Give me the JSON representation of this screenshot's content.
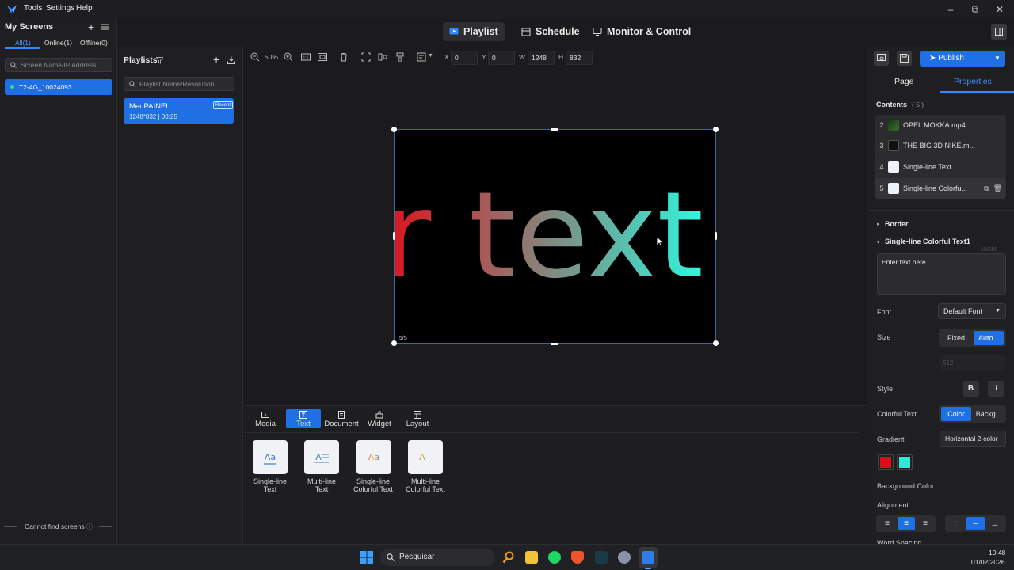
{
  "menu": {
    "tools": "Tools",
    "settings": "Settings",
    "help": "Help"
  },
  "nav": {
    "playlist": "Playlist",
    "schedule": "Schedule",
    "monitor": "Monitor & Control"
  },
  "screens": {
    "title": "My Screens",
    "tabs": {
      "all": "All(1)",
      "online": "Online(1)",
      "offline": "Offline(0)"
    },
    "search_placeholder": "Screen Name/IP Address...",
    "device": "T2-4G_10024093",
    "footer": "Cannot find screens"
  },
  "playlists": {
    "title": "Playlists",
    "search_placeholder": "Playlist Name/Resolution",
    "item": {
      "name": "MeuPAINEL",
      "badge": "Recent",
      "meta": "1248*832 | 00:25"
    }
  },
  "toolbar": {
    "zoom": "50%",
    "x_label": "X",
    "x": "0",
    "y_label": "Y",
    "y": "0",
    "w_label": "W",
    "w": "1248",
    "h_label": "H",
    "h": "832"
  },
  "canvas": {
    "text": "r text",
    "page_counter": "5/5",
    "gradient": {
      "from": "#e0101a",
      "to": "#2ef7de"
    }
  },
  "assets": {
    "tabs": {
      "media": "Media",
      "text": "Text",
      "document": "Document",
      "widget": "Widget",
      "layout": "Layout"
    },
    "items": [
      {
        "line1": "Single-line",
        "line2": "Text"
      },
      {
        "line1": "Multi-line",
        "line2": "Text"
      },
      {
        "line1": "Single-line",
        "line2": "Colorful Text"
      },
      {
        "line1": "Multi-line",
        "line2": "Colorful Text"
      }
    ]
  },
  "props": {
    "publish": "Publish",
    "tab_page": "Page",
    "tab_properties": "Properties",
    "contents_label": "Contents",
    "contents_count": "( 5 )",
    "contents": [
      {
        "num": "2",
        "name": "OPEL MOKKA.mp4"
      },
      {
        "num": "3",
        "name": "THE BIG 3D NIKE.m..."
      },
      {
        "num": "4",
        "name": "Single-line Text"
      },
      {
        "num": "5",
        "name": "Single-line Colorfu..."
      }
    ],
    "border": "Border",
    "section": "Single-line Colorful Text1",
    "char_count": "15/500",
    "text_value": "Enter text here",
    "font_label": "Font",
    "font_value": "Default Font",
    "size_label": "Size",
    "size_fixed": "Fixed",
    "size_auto": "Auto...",
    "size_value": "512",
    "style_label": "Style",
    "bold": "B",
    "italic": "I",
    "colorful_label": "Colorful Text",
    "color_opt": "Color",
    "bg_opt": "Backg...",
    "gradient_label": "Gradient",
    "gradient_value": "Horizontal 2-color",
    "color1": "#d80f16",
    "color2": "#2ee9da",
    "bg_color_label": "Background Color",
    "alignment_label": "Alignment",
    "word_spacing_label": "Word Spacing"
  },
  "taskbar": {
    "search": "Pesquisar",
    "time": "10:48",
    "date": "01/02/2026"
  }
}
